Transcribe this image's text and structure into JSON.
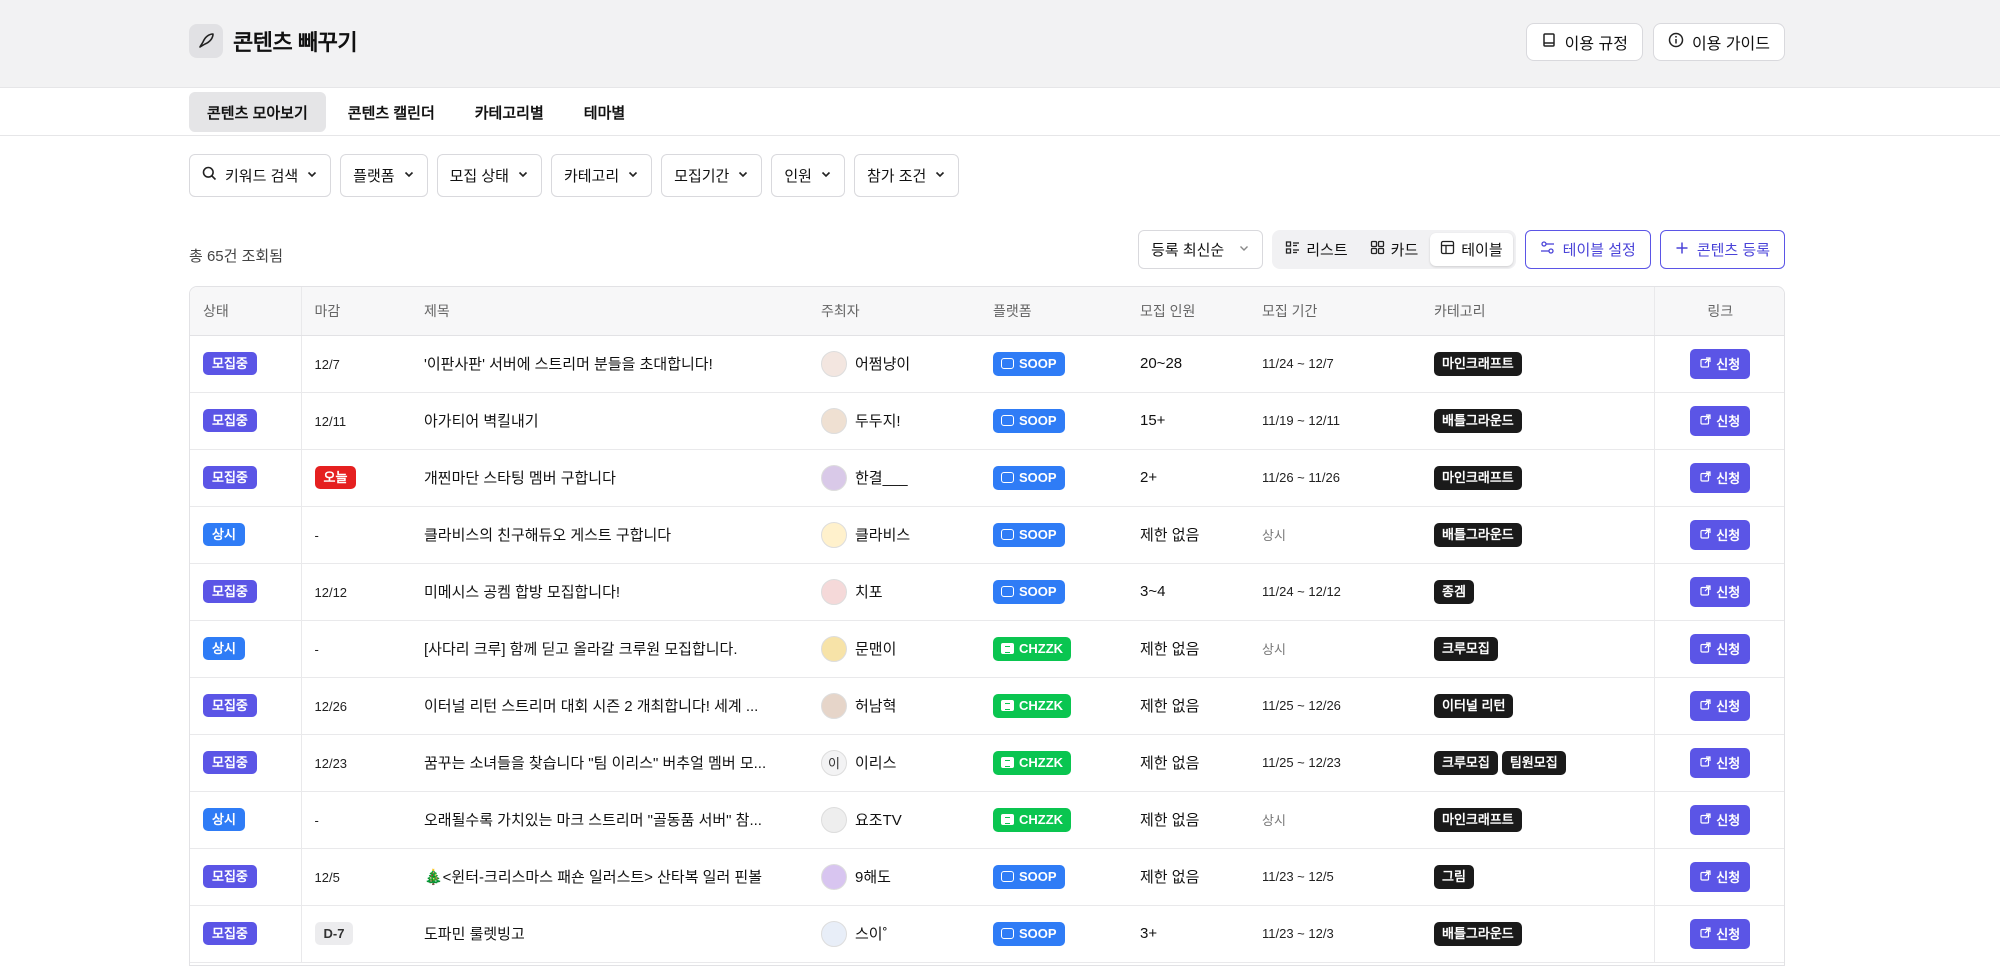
{
  "app": {
    "title": "콘텐츠 빼꾸기",
    "rules_label": "이용 규정",
    "guide_label": "이용 가이드"
  },
  "nav": {
    "tabs": [
      {
        "label": "콘텐츠 모아보기",
        "active": true
      },
      {
        "label": "콘텐츠 캘린더",
        "active": false
      },
      {
        "label": "카테고리별",
        "active": false
      },
      {
        "label": "테마별",
        "active": false
      }
    ]
  },
  "filters": [
    {
      "label": "키워드 검색",
      "icon": "search-icon"
    },
    {
      "label": "플랫폼"
    },
    {
      "label": "모집 상태"
    },
    {
      "label": "카테고리"
    },
    {
      "label": "모집기간"
    },
    {
      "label": "인원"
    },
    {
      "label": "참가 조건"
    }
  ],
  "results": {
    "count_text": "총 65건 조회됨",
    "sort_value": "등록 최신순",
    "views": [
      {
        "label": "리스트",
        "icon": "list-icon",
        "active": false
      },
      {
        "label": "카드",
        "icon": "grid-icon",
        "active": false
      },
      {
        "label": "테이블",
        "icon": "table-icon",
        "active": true
      }
    ],
    "table_settings_label": "테이블 설정",
    "register_label": "콘텐츠 등록"
  },
  "colors": {
    "recruiting": "#5b55e6",
    "always": "#2f7cf6",
    "soop": "#2f7cf6",
    "chzzk": "#0ac550",
    "today": "#e52020"
  },
  "table": {
    "headers": [
      "상태",
      "마감",
      "제목",
      "주최자",
      "플랫폼",
      "모집 인원",
      "모집 기간",
      "카테고리",
      "링크"
    ],
    "rows": [
      {
        "status": "모집중",
        "status_type": "recruiting",
        "deadline": "12/7",
        "deadline_type": "text",
        "title": "'이판사판' 서버에 스트리머 분들을 초대합니다!",
        "host": "어쩜냥이",
        "avatar": "",
        "platform": "SOOP",
        "members": "20~28",
        "period": "11/24 ~ 12/7",
        "categories": [
          "마인크래프트"
        ],
        "link": "신청"
      },
      {
        "status": "모집중",
        "status_type": "recruiting",
        "deadline": "12/11",
        "deadline_type": "text",
        "title": "아가티어 벽킬내기",
        "host": "두두지!",
        "avatar": "",
        "platform": "SOOP",
        "members": "15+",
        "period": "11/19 ~ 12/11",
        "categories": [
          "배틀그라운드"
        ],
        "link": "신청"
      },
      {
        "status": "모집중",
        "status_type": "recruiting",
        "deadline": "오늘",
        "deadline_type": "today",
        "title": "개찐마단 스타팅 멤버 구합니다",
        "host": "한결___",
        "avatar": "",
        "platform": "SOOP",
        "members": "2+",
        "period": "11/26 ~ 11/26",
        "categories": [
          "마인크래프트"
        ],
        "link": "신청"
      },
      {
        "status": "상시",
        "status_type": "always",
        "deadline": "-",
        "deadline_type": "text",
        "title": "클라비스의 친구해듀오 게스트 구합니다",
        "host": "클라비스",
        "avatar": "",
        "platform": "SOOP",
        "members": "제한 없음",
        "period": "상시",
        "categories": [
          "배틀그라운드"
        ],
        "link": "신청"
      },
      {
        "status": "모집중",
        "status_type": "recruiting",
        "deadline": "12/12",
        "deadline_type": "text",
        "title": "미메시스 공켐 합방 모집합니다!",
        "host": "치포",
        "avatar": "",
        "platform": "SOOP",
        "members": "3~4",
        "period": "11/24 ~ 12/12",
        "categories": [
          "종겜"
        ],
        "link": "신청"
      },
      {
        "status": "상시",
        "status_type": "always",
        "deadline": "-",
        "deadline_type": "text",
        "title": "[사다리 크루] 함께 딛고 올라갈 크루원 모집합니다.",
        "host": "문맨이",
        "avatar": "",
        "platform": "CHZZK",
        "members": "제한 없음",
        "period": "상시",
        "categories": [
          "크루모집"
        ],
        "link": "신청"
      },
      {
        "status": "모집중",
        "status_type": "recruiting",
        "deadline": "12/26",
        "deadline_type": "text",
        "title": "이터널 리턴 스트리머 대회 시즌 2 개최합니다! 세계 ...",
        "host": "허남혁",
        "avatar": "",
        "platform": "CHZZK",
        "members": "제한 없음",
        "period": "11/25 ~ 12/26",
        "categories": [
          "이터널 리턴"
        ],
        "link": "신청"
      },
      {
        "status": "모집중",
        "status_type": "recruiting",
        "deadline": "12/23",
        "deadline_type": "text",
        "title": "꿈꾸는 소녀들을 찾습니다 \"팀 이리스\" 버추얼 멤버 모...",
        "host": "이리스",
        "avatar": "이",
        "platform": "CHZZK",
        "members": "제한 없음",
        "period": "11/25 ~ 12/23",
        "categories": [
          "크루모집",
          "팀원모집"
        ],
        "link": "신청"
      },
      {
        "status": "상시",
        "status_type": "always",
        "deadline": "-",
        "deadline_type": "text",
        "title": "오래될수록 가치있는 마크 스트리머 \"골동품 서버\" 참...",
        "host": "요조TV",
        "avatar": "",
        "platform": "CHZZK",
        "members": "제한 없음",
        "period": "상시",
        "categories": [
          "마인크래프트"
        ],
        "link": "신청"
      },
      {
        "status": "모집중",
        "status_type": "recruiting",
        "deadline": "12/5",
        "deadline_type": "text",
        "title": "🎄<윈터-크리스마스 패숀 일러스트> 산타복 일러 핀볼",
        "host": "9해도",
        "avatar": "",
        "platform": "SOOP",
        "members": "제한 없음",
        "period": "11/23 ~ 12/5",
        "categories": [
          "그림"
        ],
        "link": "신청"
      },
      {
        "status": "모집중",
        "status_type": "recruiting",
        "deadline": "D-7",
        "deadline_type": "dday",
        "title": "도파민 룰렛빙고",
        "host": "스이˚",
        "avatar": "",
        "platform": "SOOP",
        "members": "3+",
        "period": "11/23 ~ 12/3",
        "categories": [
          "배틀그라운드"
        ],
        "link": "신청"
      }
    ]
  }
}
